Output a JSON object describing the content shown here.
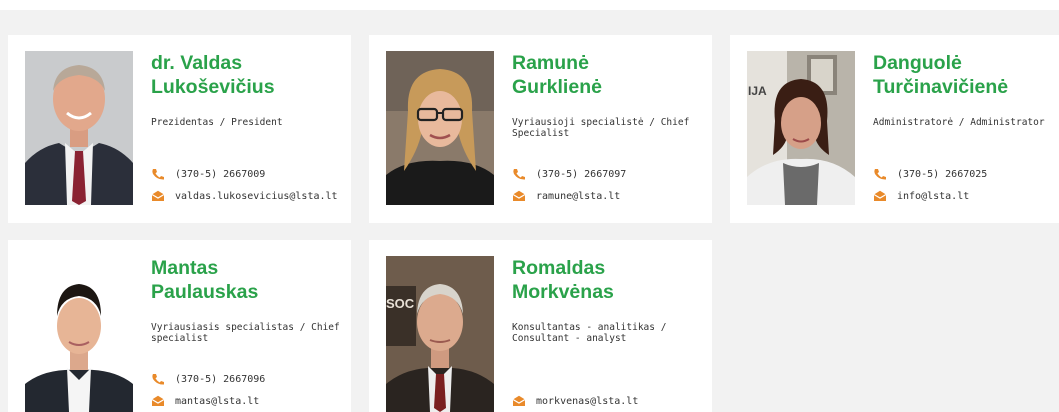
{
  "colors": {
    "name_green": "#2aa24a",
    "icon_orange": "#e98a2a",
    "card_bg": "#ffffff",
    "page_bg": "#f2f2f2"
  },
  "staff": [
    {
      "name_line1": "dr. Valdas",
      "name_line2": "Lukoševičius",
      "role": "Prezidentas / President",
      "phone": "(370-5) 2667009",
      "email": "valdas.lukosevicius@lsta.lt",
      "phone_icon": "phone-icon",
      "email_icon": "envelope-icon"
    },
    {
      "name_line1": "Ramunė",
      "name_line2": "Gurklienė",
      "role": "Vyriausioji specialistė / Chief Specialist",
      "phone": "(370-5) 2667097",
      "email": "ramune@lsta.lt",
      "phone_icon": "phone-icon",
      "email_icon": "envelope-icon"
    },
    {
      "name_line1": "Danguolė",
      "name_line2": "Turčinavičienė",
      "role": "Administratorė / Administrator",
      "phone": "(370-5) 2667025",
      "email": "info@lsta.lt",
      "phone_icon": "phone-icon",
      "email_icon": "envelope-icon",
      "photo_text": "IJA"
    },
    {
      "name_line1": "Mantas",
      "name_line2": "Paulauskas",
      "role": "Vyriausiasis specialistas / Chief specialist",
      "phone": "(370-5) 2667096",
      "email": "mantas@lsta.lt",
      "phone_icon": "phone-icon",
      "email_icon": "envelope-icon"
    },
    {
      "name_line1": "Romaldas",
      "name_line2": "Morkvėnas",
      "role": "Konsultantas - analitikas / Consultant - analyst",
      "email": "morkvenas@lsta.lt",
      "email_icon": "envelope-icon",
      "photo_text": "SOC"
    }
  ]
}
